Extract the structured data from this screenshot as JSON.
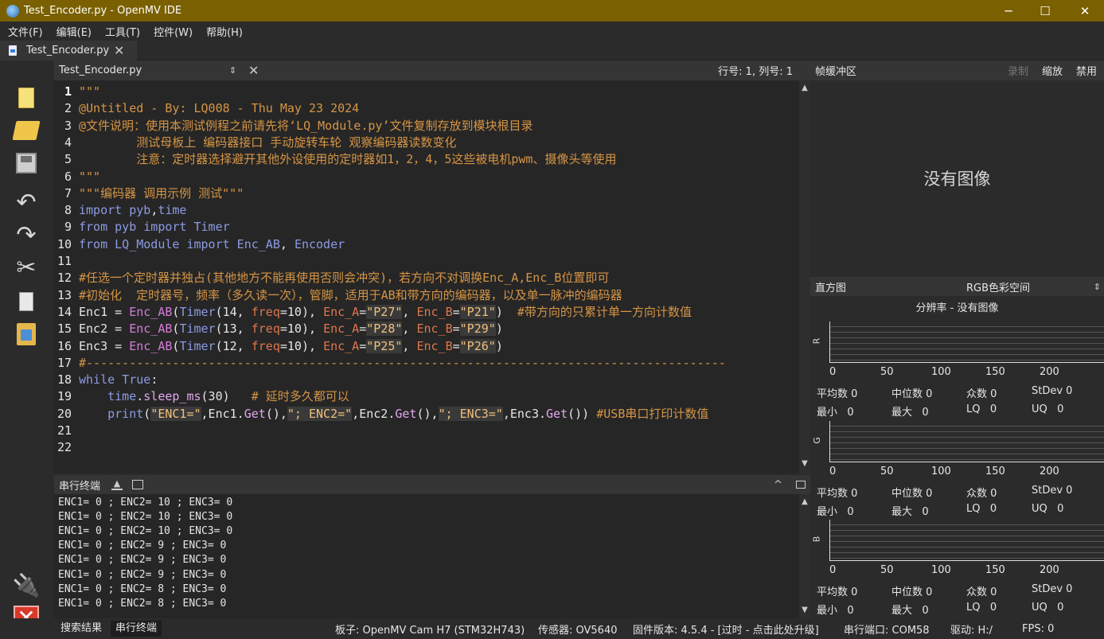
{
  "window": {
    "title": "Test_Encoder.py - OpenMV IDE",
    "minimize": "─",
    "maximize": "☐",
    "close": "✕"
  },
  "menu": [
    "文件(F)",
    "编辑(E)",
    "工具(T)",
    "控件(W)",
    "帮助(H)"
  ],
  "file_tab": {
    "label": "Test_Encoder.py",
    "close": "✕"
  },
  "toolbar_icons": [
    "new-file-icon",
    "open-folder-icon",
    "save-icon",
    "undo-icon",
    "redo-icon",
    "cut-icon",
    "copy-icon",
    "paste-icon",
    "connect-icon",
    "stop-icon"
  ],
  "editor": {
    "filename": "Test_Encoder.py",
    "updown": "⇕",
    "close": "✕",
    "cursor_pos": "行号: 1, 列号: 1"
  },
  "code_lines": [
    {
      "n": "1",
      "parts": [
        [
          "c-str",
          "\"\"\""
        ]
      ]
    },
    {
      "n": "2",
      "parts": [
        [
          "c-str",
          "@Untitled - By: LQ008 - Thu May 23 2024"
        ]
      ]
    },
    {
      "n": "3",
      "parts": [
        [
          "c-str",
          "@文件说明：使用本测试例程之前请先将‘LQ_Module.py’文件复制存放到模块根目录"
        ]
      ]
    },
    {
      "n": "4",
      "parts": [
        [
          "c-str",
          "        测试母板上 编码器接口 手动旋转车轮 观察编码器读数变化"
        ]
      ]
    },
    {
      "n": "5",
      "parts": [
        [
          "c-str",
          "        注意：定时器选择避开其他外设使用的定时器如1，2，4，5这些被电机pwm、摄像头等使用"
        ]
      ]
    },
    {
      "n": "6",
      "parts": [
        [
          "c-str",
          "\"\"\""
        ]
      ]
    },
    {
      "n": "7",
      "parts": [
        [
          "c-str",
          "\"\"\"编码器 调用示例 测试\"\"\""
        ]
      ]
    },
    {
      "n": "8",
      "parts": [
        [
          "c-kw",
          "import"
        ],
        [
          "c-kw",
          " pyb"
        ],
        [
          "c-pl",
          ","
        ],
        [
          "c-kw",
          "time"
        ]
      ]
    },
    {
      "n": "9",
      "parts": [
        [
          "c-kw",
          "from"
        ],
        [
          "c-kw",
          " pyb "
        ],
        [
          "c-kw",
          "import"
        ],
        [
          "c-kw",
          " Timer"
        ]
      ]
    },
    {
      "n": "10",
      "parts": [
        [
          "c-kw",
          "from"
        ],
        [
          "c-kw",
          " LQ_Module "
        ],
        [
          "c-kw",
          "import"
        ],
        [
          "c-kw",
          " Enc_AB"
        ],
        [
          "c-pl",
          ", "
        ],
        [
          "c-kw",
          "Encoder"
        ]
      ]
    },
    {
      "n": "11",
      "parts": [
        [
          "c-pl",
          ""
        ]
      ]
    },
    {
      "n": "12",
      "parts": [
        [
          "c-cm",
          "#任选一个定时器并独占(其他地方不能再使用否则会冲突)，若方向不对调换Enc_A,Enc_B位置即可"
        ]
      ]
    },
    {
      "n": "13",
      "parts": [
        [
          "c-cm",
          "#初始化  定时器号，频率（多久读一次），管脚，适用于AB和带方向的编码器，以及单一脉冲的编码器"
        ]
      ]
    },
    {
      "n": "14",
      "parts": [
        [
          "c-pl",
          "Enc1 = "
        ],
        [
          "c-cls",
          "Enc_AB"
        ],
        [
          "c-pl",
          "("
        ],
        [
          "c-kw",
          "Timer"
        ],
        [
          "c-pl",
          "(14, "
        ],
        [
          "c-arg",
          "freq"
        ],
        [
          "c-pl",
          "=10), "
        ],
        [
          "c-arg",
          "Enc_A"
        ],
        [
          "c-pl",
          "="
        ],
        [
          "c-s2",
          "\"P27\""
        ],
        [
          "c-pl",
          ", "
        ],
        [
          "c-arg",
          "Enc_B"
        ],
        [
          "c-pl",
          "="
        ],
        [
          "c-s2",
          "\"P21\""
        ],
        [
          "c-pl",
          ")  "
        ],
        [
          "c-cm",
          "#带方向的只累计单一方向计数值"
        ]
      ]
    },
    {
      "n": "15",
      "parts": [
        [
          "c-pl",
          "Enc2 = "
        ],
        [
          "c-cls",
          "Enc_AB"
        ],
        [
          "c-pl",
          "("
        ],
        [
          "c-kw",
          "Timer"
        ],
        [
          "c-pl",
          "(13, "
        ],
        [
          "c-arg",
          "freq"
        ],
        [
          "c-pl",
          "=10), "
        ],
        [
          "c-arg",
          "Enc_A"
        ],
        [
          "c-pl",
          "="
        ],
        [
          "c-s2",
          "\"P28\""
        ],
        [
          "c-pl",
          ", "
        ],
        [
          "c-arg",
          "Enc_B"
        ],
        [
          "c-pl",
          "="
        ],
        [
          "c-s2",
          "\"P29\""
        ],
        [
          "c-pl",
          ")"
        ]
      ]
    },
    {
      "n": "16",
      "parts": [
        [
          "c-pl",
          "Enc3 = "
        ],
        [
          "c-cls",
          "Enc_AB"
        ],
        [
          "c-pl",
          "("
        ],
        [
          "c-kw",
          "Timer"
        ],
        [
          "c-pl",
          "(12, "
        ],
        [
          "c-arg",
          "freq"
        ],
        [
          "c-pl",
          "=10), "
        ],
        [
          "c-arg",
          "Enc_A"
        ],
        [
          "c-pl",
          "="
        ],
        [
          "c-s2",
          "\"P25\""
        ],
        [
          "c-pl",
          ", "
        ],
        [
          "c-arg",
          "Enc_B"
        ],
        [
          "c-pl",
          "="
        ],
        [
          "c-s2",
          "\"P26\""
        ],
        [
          "c-pl",
          ")"
        ]
      ]
    },
    {
      "n": "17",
      "parts": [
        [
          "c-cm",
          "#-----------------------------------------------------------------------------------------"
        ]
      ]
    },
    {
      "n": "18",
      "parts": [
        [
          "c-kw",
          "while"
        ],
        [
          "c-kw",
          " True"
        ],
        [
          "c-pl",
          ":"
        ]
      ]
    },
    {
      "n": "19",
      "parts": [
        [
          "c-pl",
          "    "
        ],
        [
          "c-kw",
          "time"
        ],
        [
          "c-pl",
          "."
        ],
        [
          "c-fn",
          "sleep_ms"
        ],
        [
          "c-pl",
          "(30)   "
        ],
        [
          "c-cm",
          "# 延时多久都可以"
        ]
      ]
    },
    {
      "n": "20",
      "parts": [
        [
          "c-pl",
          "    "
        ],
        [
          "c-kw",
          "print"
        ],
        [
          "c-pl",
          "("
        ],
        [
          "c-s2",
          "\"ENC1=\""
        ],
        [
          "c-pl",
          ",Enc1."
        ],
        [
          "c-fn",
          "Get"
        ],
        [
          "c-pl",
          "(),"
        ],
        [
          "c-s2",
          "\"; ENC2=\""
        ],
        [
          "c-pl",
          ",Enc2."
        ],
        [
          "c-fn",
          "Get"
        ],
        [
          "c-pl",
          "(),"
        ],
        [
          "c-s2",
          "\"; ENC3=\""
        ],
        [
          "c-pl",
          ",Enc3."
        ],
        [
          "c-fn",
          "Get"
        ],
        [
          "c-pl",
          "()) "
        ],
        [
          "c-cm",
          "#USB串口打印计数值"
        ]
      ]
    },
    {
      "n": "21",
      "parts": [
        [
          "c-pl",
          ""
        ]
      ]
    },
    {
      "n": "22",
      "parts": [
        [
          "c-pl",
          ""
        ]
      ]
    }
  ],
  "terminal": {
    "title": "串行终端",
    "lines": [
      "ENC1= 0 ; ENC2= 10 ; ENC3= 0",
      "ENC1= 0 ; ENC2= 10 ; ENC3= 0",
      "ENC1= 0 ; ENC2= 10 ; ENC3= 0",
      "ENC1= 0 ; ENC2= 9 ; ENC3= 0",
      "ENC1= 0 ; ENC2= 9 ; ENC3= 0",
      "ENC1= 0 ; ENC2= 9 ; ENC3= 0",
      "ENC1= 0 ; ENC2= 8 ; ENC3= 0",
      "ENC1= 0 ; ENC2= 8 ; ENC3= 0"
    ]
  },
  "framebuffer": {
    "title": "帧缓冲区",
    "record": "录制",
    "zoom": "缩放",
    "disable": "禁用",
    "no_image": "没有图像"
  },
  "histogram": {
    "title": "直方图",
    "colorspace": "RGB色彩空间",
    "resolution": "分辨率 - 没有图像",
    "ticks": [
      "0",
      "50",
      "100",
      "150",
      "200"
    ],
    "channels": [
      {
        "label": "R",
        "mean": "平均数 0",
        "median": "中位数 0",
        "mode": "众数 0",
        "stdev": "StDev 0",
        "min": "最小   0",
        "max": "最大   0",
        "lq": "LQ   0",
        "uq": "UQ   0"
      },
      {
        "label": "G",
        "mean": "平均数 0",
        "median": "中位数 0",
        "mode": "众数 0",
        "stdev": "StDev 0",
        "min": "最小   0",
        "max": "最大   0",
        "lq": "LQ   0",
        "uq": "UQ   0"
      },
      {
        "label": "B",
        "mean": "平均数 0",
        "median": "中位数 0",
        "mode": "众数 0",
        "stdev": "StDev 0",
        "min": "最小   0",
        "max": "最大   0",
        "lq": "LQ   0",
        "uq": "UQ   0"
      }
    ]
  },
  "status": {
    "tab_search": "搜索结果",
    "tab_terminal": "串行终端",
    "board": "板子: OpenMV Cam H7 (STM32H743)",
    "sensor": "传感器: OV5640",
    "firmware": "固件版本: 4.5.4 - [过时 - 点击此处升级]",
    "port": "串行端口: COM58",
    "drive": "驱动: H:/",
    "fps": "FPS: 0"
  }
}
